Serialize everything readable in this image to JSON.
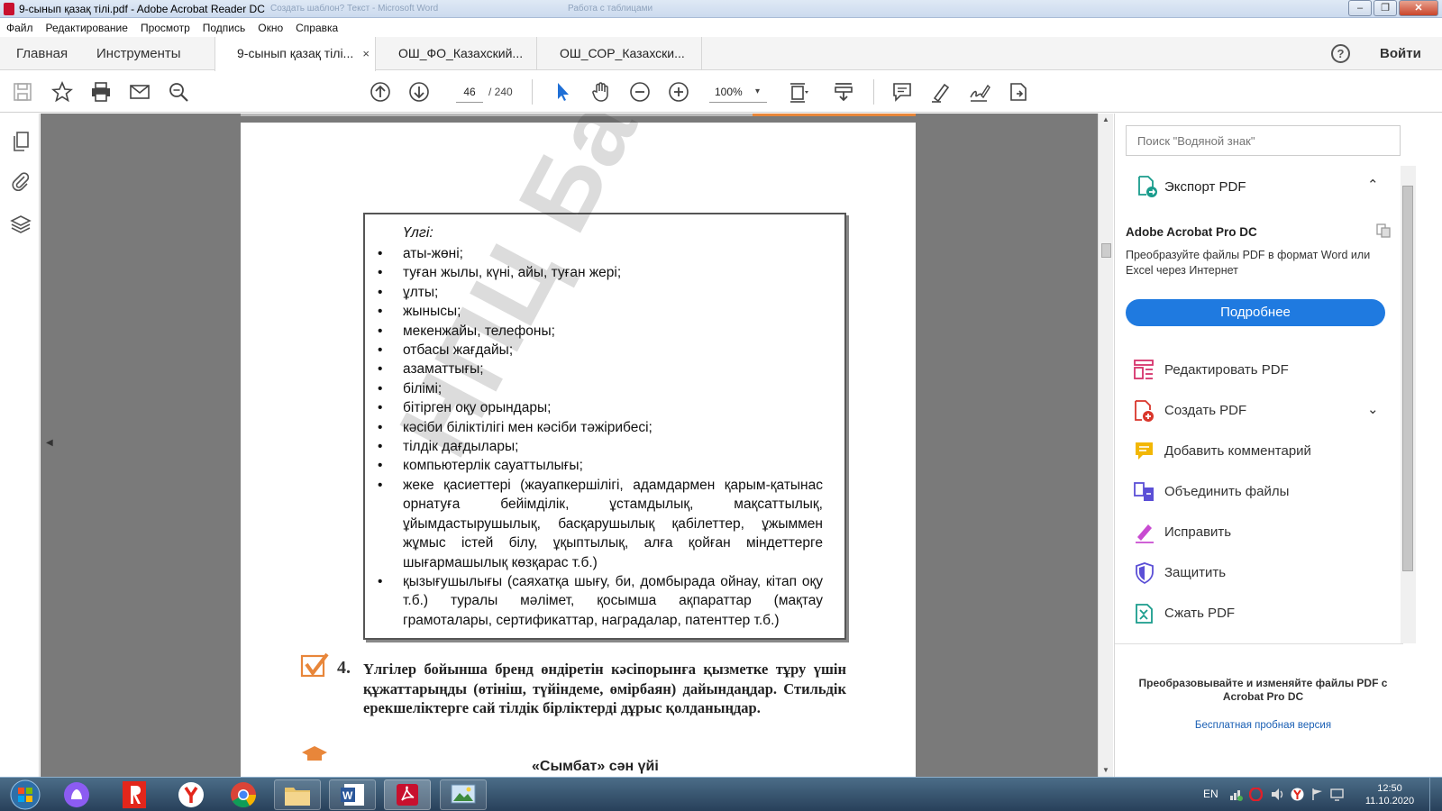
{
  "window": {
    "title": "9-сынып қазақ тілі.pdf - Adobe Acrobat Reader DC",
    "ghost_titles": [
      "Создать шаблон? Текст - Microsoft Word",
      "Работа с таблицами"
    ]
  },
  "menu": [
    "Файл",
    "Редактирование",
    "Просмотр",
    "Подпись",
    "Окно",
    "Справка"
  ],
  "tabs": {
    "home": "Главная",
    "tools": "Инструменты",
    "docs": [
      {
        "label": "9-сынып қазақ тілі...",
        "active": true,
        "close": "×"
      },
      {
        "label": "ОШ_ФО_Казахский...",
        "active": false
      },
      {
        "label": "ОШ_СОР_Казахски...",
        "active": false
      }
    ],
    "help": "?",
    "signin": "Войти"
  },
  "toolbar": {
    "page_current": "46",
    "page_total": "/  240",
    "zoom": "100%",
    "zoom_arrow": "▾"
  },
  "document": {
    "watermark": "НПЦ Баспасы",
    "sample_title": "Үлгі:",
    "sample_items": [
      "аты-жөні;",
      "туған жылы, күні, айы, туған жері;",
      "ұлты;",
      "жынысы;",
      "мекенжайы, телефоны;",
      "отбасы жағдайы;",
      "азаматтығы;",
      "білімі;",
      "бітірген оқу орындары;",
      "кәсіби біліктілігі мен кәсіби тәжірибесі;",
      "тілдік дағдылары;",
      "компьютерлік сауаттылығы;",
      "жеке қасиеттері (жауапкершілігі, адамдармен қарым-қатынас орнатуға бейімділік, ұстамдылық, мақсаттылық, ұйымдастырушылық, басқарушылық қабілеттер, ұжыммен жұмыс істей білу, ұқыптылық, алға қойған міндеттерге шығармашылық көзқарас т.б.)",
      "қызығушылығы (саяхатқа шығу, би, домбырада ойнау, кітап оқу т.б.) туралы мәлімет, қосымша ақпараттар (мақтау грамоталары, сертификаттар, наградалар, патенттер т.б.)"
    ],
    "task_number": "4.",
    "task_text": "Үлгілер бойынша бренд өндіретін кәсіпорынға қызметке тұру үшін құжаттарыңды (өтініш, түйіндеме, өмірбаян) дайындаңдар. Стильдік ерекшеліктерге сай тілдік бірліктерді дұрыс қолданыңдар.",
    "bottom_text": "«Сымбат» сән үйі"
  },
  "right_panel": {
    "search_placeholder": "Поиск \"Водяной знак\"",
    "export_label": "Экспорт PDF",
    "promo_title": "Adobe Acrobat Pro DC",
    "promo_desc": "Преобразуйте файлы PDF в формат Word или Excel через Интернет",
    "promo_button": "Подробнее",
    "tools": [
      {
        "label": "Редактировать PDF",
        "icon": "edit-pdf-icon"
      },
      {
        "label": "Создать PDF",
        "icon": "create-pdf-icon"
      },
      {
        "label": "Добавить комментарий",
        "icon": "comment-icon"
      },
      {
        "label": "Объединить файлы",
        "icon": "combine-icon"
      },
      {
        "label": "Исправить",
        "icon": "fill-sign-icon"
      },
      {
        "label": "Защитить",
        "icon": "protect-icon"
      },
      {
        "label": "Сжать PDF",
        "icon": "compress-icon"
      }
    ],
    "footer_text": "Преобразовывайте и изменяйте файлы PDF с Acrobat Pro DC",
    "footer_link": "Бесплатная пробная версия"
  },
  "taskbar": {
    "lang": "EN",
    "time": "12:50",
    "date": "11.10.2020"
  },
  "colors": {
    "accent_blue": "#1f7ae0",
    "acrobat_red": "#c8102e",
    "orange": "#e8863a"
  }
}
